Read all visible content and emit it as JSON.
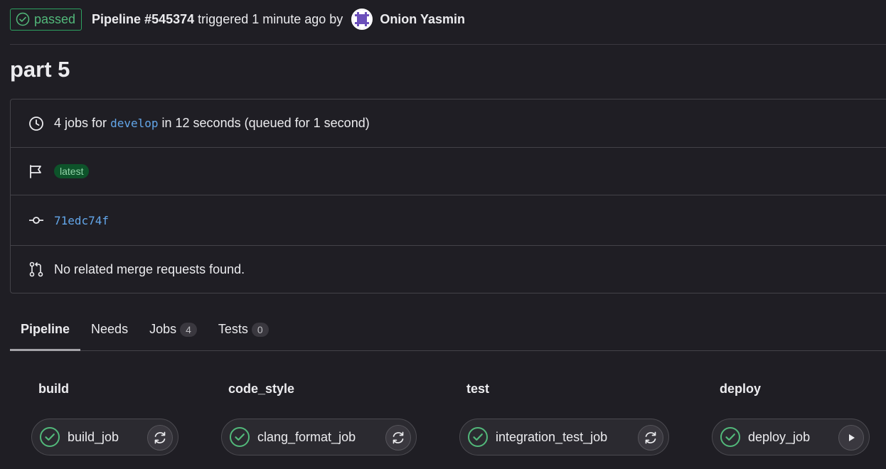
{
  "header": {
    "status": "passed",
    "pipeline": "Pipeline #545374",
    "triggered_text": "triggered 1 minute ago by",
    "author": "Onion Yasmin"
  },
  "title": "part 5",
  "info": {
    "jobs_prefix": "4 jobs for",
    "branch": "develop",
    "jobs_suffix": "in 12 seconds (queued for 1 second)",
    "tag": "latest",
    "commit": "71edc74f",
    "merge_requests": "No related merge requests found."
  },
  "tabs": [
    {
      "label": "Pipeline"
    },
    {
      "label": "Needs"
    },
    {
      "label": "Jobs",
      "count": "4"
    },
    {
      "label": "Tests",
      "count": "0"
    }
  ],
  "stages": [
    {
      "name": "build",
      "job": "build_job",
      "action": "retry-icon"
    },
    {
      "name": "code_style",
      "job": "clang_format_job",
      "action": "retry-icon"
    },
    {
      "name": "test",
      "job": "integration_test_job",
      "action": "retry-icon"
    },
    {
      "name": "deploy",
      "job": "deploy_job",
      "action": "play-icon"
    }
  ],
  "colors": {
    "success": "#52b87a",
    "link": "#63a6e9",
    "background": "#1f1e24"
  }
}
